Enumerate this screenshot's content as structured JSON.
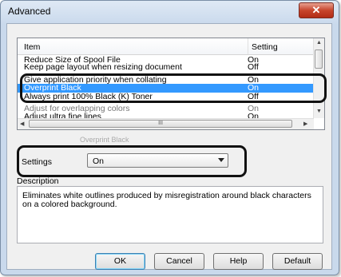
{
  "window": {
    "title": "Advanced",
    "close_label": "✕"
  },
  "list": {
    "columns": {
      "item": "Item",
      "setting": "Setting"
    },
    "rows": [
      {
        "name": "Reduce Size of Spool File",
        "value": "On"
      },
      {
        "name": "Keep page layout when resizing document",
        "value": "Off"
      },
      {
        "name": "Give application priority when collating",
        "value": "On"
      },
      {
        "name": "Overprint Black",
        "value": "On",
        "selected": true
      },
      {
        "name": "Always print 100% Black (K) Toner",
        "value": "Off"
      },
      {
        "name": "Adjust for overlapping colors",
        "value": "On"
      },
      {
        "name": "Adjust ultra fine lines",
        "value": "On"
      }
    ],
    "hscroll_grip": "III"
  },
  "settings": {
    "label": "Settings",
    "value": "On",
    "ghost_text": "Overprint Black"
  },
  "description": {
    "title": "Description",
    "text": "Eliminates white outlines produced by misregistration around black characters on a colored background."
  },
  "buttons": {
    "ok": "OK",
    "cancel": "Cancel",
    "help": "Help",
    "default": "Default"
  },
  "colors": {
    "selection": "#3399ff",
    "title_bg": "#c9d9ec",
    "close_button": "#c7452c"
  }
}
